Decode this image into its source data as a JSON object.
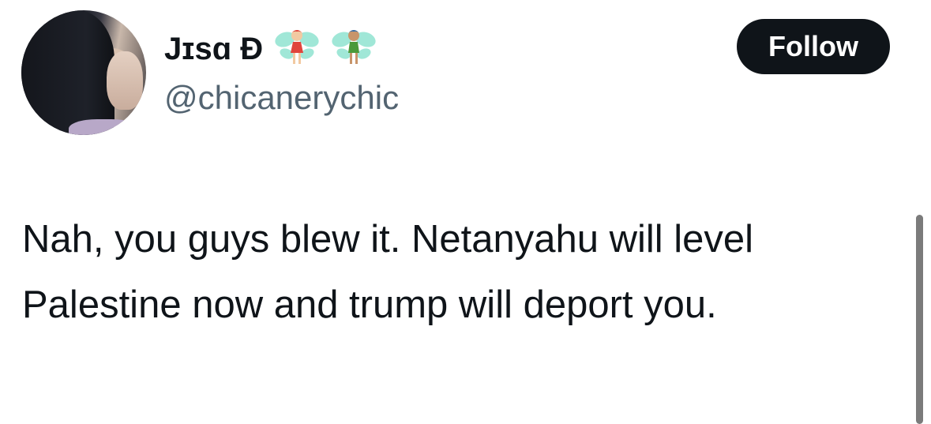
{
  "tweet": {
    "author": {
      "display_name": "Jɪsɑ Đ",
      "handle": "@chicanerychic",
      "emoji": [
        "fairy-emoji-red",
        "fairy-emoji-green"
      ]
    },
    "follow_label": "Follow",
    "text": "Nah, you guys blew it. Netanyahu will level Palestine now and trump will deport you."
  },
  "colors": {
    "text_primary": "#0f1419",
    "text_secondary": "#536471",
    "button_bg": "#0f1419",
    "button_text": "#ffffff"
  }
}
